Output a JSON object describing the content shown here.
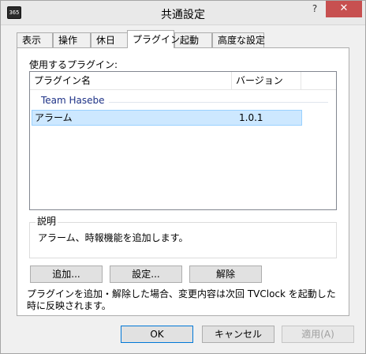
{
  "window": {
    "title": "共通設定",
    "icon_label": "365",
    "help_glyph": "?",
    "close_glyph": "✕"
  },
  "tabs": [
    {
      "label": "表示",
      "active": false
    },
    {
      "label": "操作",
      "active": false
    },
    {
      "label": "休日",
      "active": false
    },
    {
      "label": "プラグイン",
      "active": true
    },
    {
      "label": "起動",
      "active": false
    },
    {
      "label": "高度な設定",
      "active": false
    }
  ],
  "plugins": {
    "section_label": "使用するプラグイン:",
    "columns": [
      "プラグイン名",
      "バージョン"
    ],
    "group": "Team Hasebe",
    "rows": [
      {
        "name": "アラーム",
        "version": "1.0.1",
        "selected": true
      }
    ]
  },
  "description": {
    "label": "説明",
    "text": "アラーム、時報機能を追加します。"
  },
  "actions": {
    "add": "追加...",
    "settings": "設定...",
    "remove": "解除"
  },
  "note": "プラグインを追加・解除した場合、変更内容は次回 TVClock を起動した時に反映されます。",
  "footer": {
    "ok": "OK",
    "cancel": "キャンセル",
    "apply": "適用(A)"
  }
}
